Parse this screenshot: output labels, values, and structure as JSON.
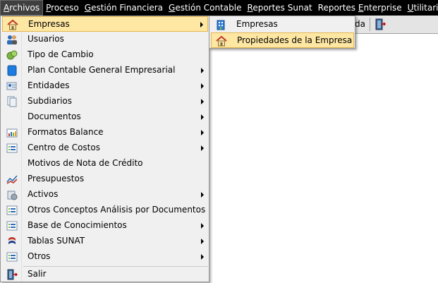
{
  "menubar": {
    "items": [
      {
        "label": "Archivos",
        "mnemonic_index": 0
      },
      {
        "label": "Proceso",
        "mnemonic_index": 0
      },
      {
        "label": "Gestión Financiera",
        "mnemonic_index": 0
      },
      {
        "label": "Gestión Contable",
        "mnemonic_index": 0
      },
      {
        "label": "Reportes Sunat",
        "mnemonic_index": 0
      },
      {
        "label": "Reportes Enterprise",
        "mnemonic_index": 9
      },
      {
        "label": "Utilitarios",
        "mnemonic_index": 0
      },
      {
        "label": "?",
        "mnemonic_index": -1
      }
    ],
    "active": "Archivos"
  },
  "toolbar": {
    "partial_text": "da",
    "exit_icon": "exit-door-icon"
  },
  "archivos_menu": {
    "items": [
      {
        "label": "Empresas",
        "icon": "house-icon",
        "submenu": true,
        "highlighted": true
      },
      {
        "label": "Usuarios",
        "icon": "users-icon",
        "submenu": false
      },
      {
        "label": "Tipo de Cambio",
        "icon": "exchange-icon",
        "submenu": false
      },
      {
        "label": "Plan Contable General Empresarial",
        "icon": "book-icon",
        "submenu": true
      },
      {
        "label": "Entidades",
        "icon": "entity-card-icon",
        "submenu": true
      },
      {
        "label": "Subdiarios",
        "icon": "documents-icon",
        "submenu": true
      },
      {
        "label": "Documentos",
        "icon": "",
        "submenu": true
      },
      {
        "label": "Formatos Balance",
        "icon": "bar-chart-icon",
        "submenu": true
      },
      {
        "label": "Centro de Costos",
        "icon": "list-icon",
        "submenu": true
      },
      {
        "label": "Motivos de Nota de Crédito",
        "icon": "",
        "submenu": false
      },
      {
        "label": "Presupuestos",
        "icon": "trend-chart-icon",
        "submenu": false
      },
      {
        "label": "Activos",
        "icon": "asset-icon",
        "submenu": true
      },
      {
        "label": "Otros Conceptos Análisis por Documentos",
        "icon": "list-icon",
        "submenu": false
      },
      {
        "label": "Base de Conocimientos",
        "icon": "list-icon",
        "submenu": true
      },
      {
        "label": "Tablas SUNAT",
        "icon": "sunat-logo-icon",
        "submenu": true
      },
      {
        "label": "Otros",
        "icon": "list-icon",
        "submenu": true
      },
      {
        "label": "Salir",
        "icon": "exit-door-icon",
        "submenu": false
      }
    ]
  },
  "empresas_submenu": {
    "items": [
      {
        "label": "Empresas",
        "icon": "building-icon",
        "highlighted": false
      },
      {
        "label": "Propiedades de la Empresa",
        "icon": "house-icon",
        "highlighted": true
      }
    ]
  },
  "colors": {
    "menubar_bg": "#000000",
    "menubar_text": "#ffffff",
    "highlight_bg": "#fee7a3",
    "highlight_border": "#e5b64f",
    "menu_bg": "#f0f0f0"
  }
}
